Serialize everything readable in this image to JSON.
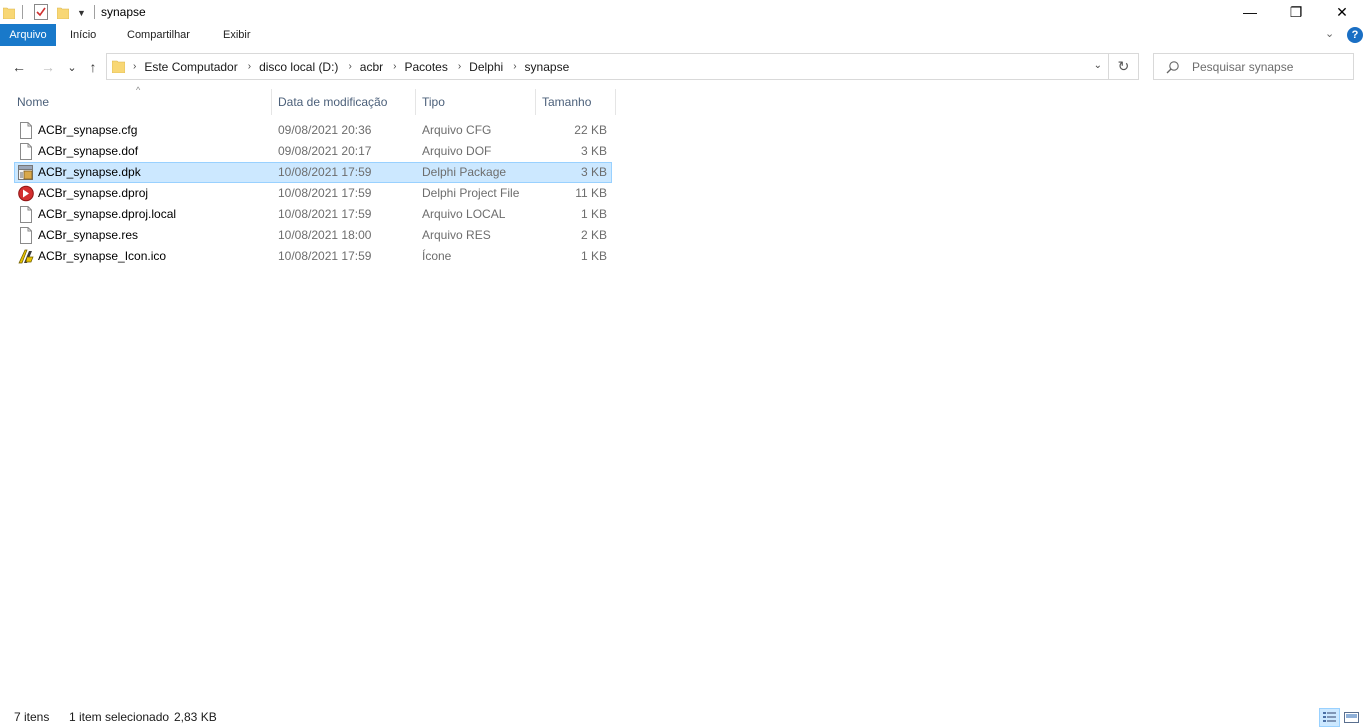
{
  "window": {
    "title": "synapse",
    "minimize_glyph": "—",
    "maximize_glyph": "❐",
    "close_glyph": "✕"
  },
  "ribbon": {
    "tabs": [
      "Arquivo",
      "Início",
      "Compartilhar",
      "Exibir"
    ],
    "collapse_glyph": "⌄",
    "help_glyph": "?"
  },
  "nav": {
    "back_glyph": "←",
    "forward_glyph": "→",
    "recent_glyph": "⌄",
    "up_glyph": "↑",
    "breadcrumbs": [
      "Este Computador",
      "disco local (D:)",
      "acbr",
      "Pacotes",
      "Delphi",
      "synapse"
    ],
    "crumb_separator": "›",
    "dropdown_glyph": "⌄",
    "refresh_glyph": "↻",
    "search_placeholder": "Pesquisar synapse"
  },
  "columns": {
    "name": "Nome",
    "date": "Data de modificação",
    "type": "Tipo",
    "size": "Tamanho",
    "sort_glyph": "^"
  },
  "files": [
    {
      "name": "ACBr_synapse.cfg",
      "date": "09/08/2021 20:36",
      "type": "Arquivo CFG",
      "size": "22 KB",
      "icon": "blank-file-icon",
      "selected": false
    },
    {
      "name": "ACBr_synapse.dof",
      "date": "09/08/2021 20:17",
      "type": "Arquivo DOF",
      "size": "3 KB",
      "icon": "blank-file-icon",
      "selected": false
    },
    {
      "name": "ACBr_synapse.dpk",
      "date": "10/08/2021 17:59",
      "type": "Delphi Package",
      "size": "3 KB",
      "icon": "delphi-package-icon",
      "selected": true
    },
    {
      "name": "ACBr_synapse.dproj",
      "date": "10/08/2021 17:59",
      "type": "Delphi Project File",
      "size": "11 KB",
      "icon": "delphi-project-icon",
      "selected": false
    },
    {
      "name": "ACBr_synapse.dproj.local",
      "date": "10/08/2021 17:59",
      "type": "Arquivo LOCAL",
      "size": "1 KB",
      "icon": "blank-file-icon",
      "selected": false
    },
    {
      "name": "ACBr_synapse.res",
      "date": "10/08/2021 18:00",
      "type": "Arquivo RES",
      "size": "2 KB",
      "icon": "blank-file-icon",
      "selected": false
    },
    {
      "name": "ACBr_synapse_Icon.ico",
      "date": "10/08/2021 17:59",
      "type": "Ícone",
      "size": "1 KB",
      "icon": "ico-image-icon",
      "selected": false
    }
  ],
  "status": {
    "item_count": "7 itens",
    "selection": "1 item selecionado",
    "selection_size": "2,83 KB"
  },
  "colors": {
    "accent": "#1979ca",
    "selection_bg": "#cce8ff",
    "selection_border": "#99d1ff",
    "folder": "#f8d775"
  }
}
